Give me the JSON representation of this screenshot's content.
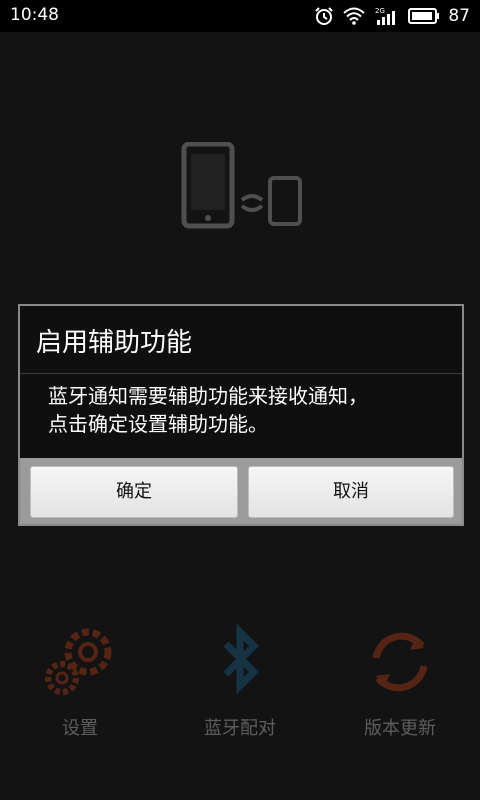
{
  "status_bar": {
    "time": "10:48",
    "battery_percent": "87"
  },
  "bottom_nav": {
    "items": [
      {
        "label": "设置",
        "icon": "gear-icon"
      },
      {
        "label": "蓝牙配对",
        "icon": "bluetooth-icon"
      },
      {
        "label": "版本更新",
        "icon": "refresh-icon"
      }
    ]
  },
  "dialog": {
    "title": "启用辅助功能",
    "message": "蓝牙通知需要辅助功能来接收通知，\n点击确定设置辅助功能。",
    "confirm_label": "确定",
    "cancel_label": "取消"
  },
  "colors": {
    "background": "#161616",
    "accent_orange": "#c8461e",
    "bluetooth_blue": "#1c6f9a"
  }
}
